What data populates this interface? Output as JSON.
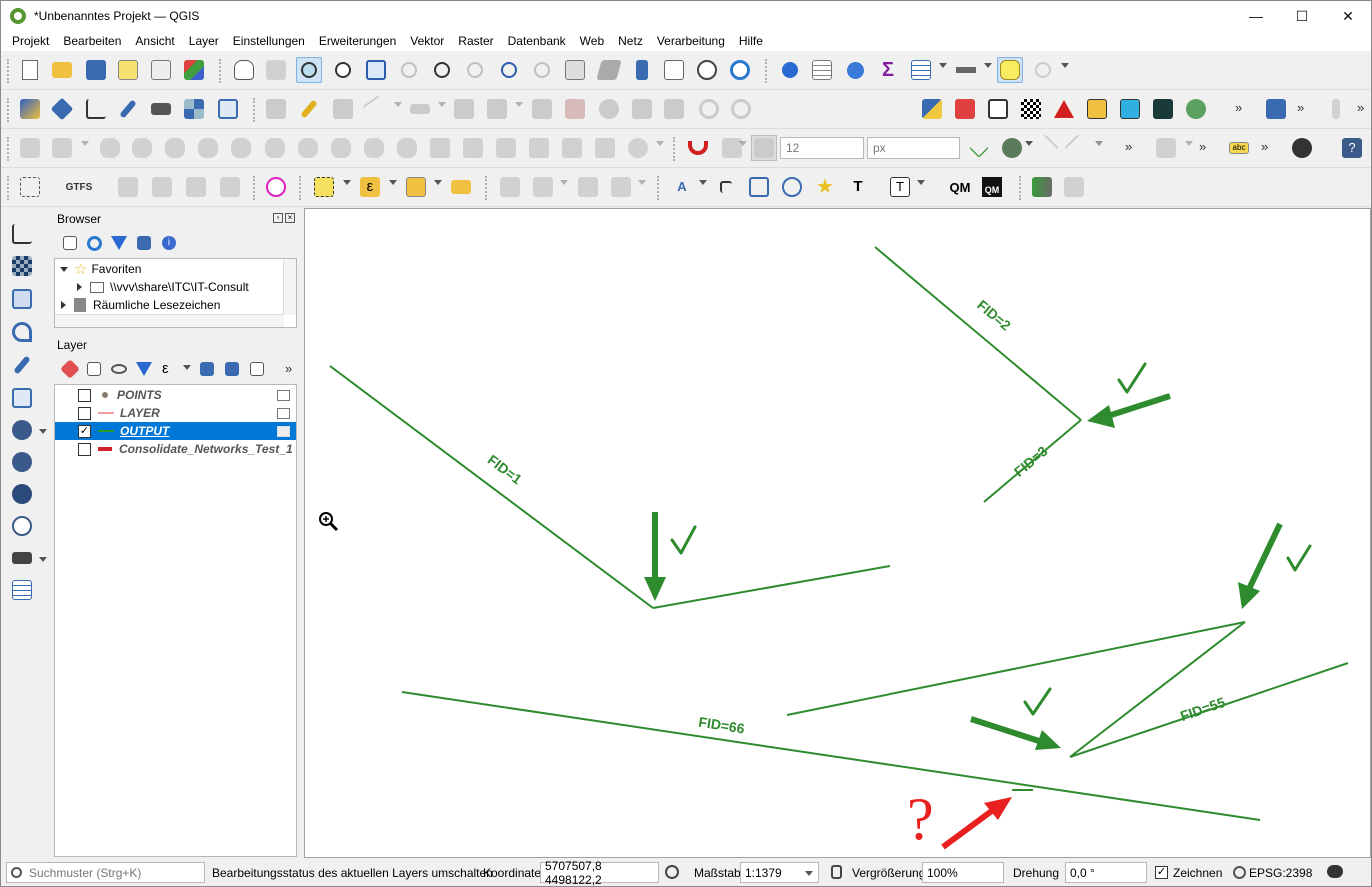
{
  "window": {
    "title": "*Unbenanntes Projekt — QGIS",
    "minimize": "—",
    "maximize": "☐",
    "close": "✕"
  },
  "menu": [
    "Projekt",
    "Bearbeiten",
    "Ansicht",
    "Layer",
    "Einstellungen",
    "Erweiterungen",
    "Vektor",
    "Raster",
    "Datenbank",
    "Web",
    "Netz",
    "Verarbeitung",
    "Hilfe"
  ],
  "toolbar": {
    "gtfs_label": "GTFS",
    "snap_tolerance": "12",
    "snap_unit": "px",
    "abc_label": "abc",
    "qm_label": "QM",
    "qm2_label": "QM",
    "more": "»"
  },
  "browser": {
    "title": "Browser",
    "items": [
      {
        "label": "Favoriten",
        "expanded": true
      },
      {
        "label": "\\\\vvv\\share\\ITC\\IT-Consult"
      },
      {
        "label": "Räumliche Lesezeichen"
      }
    ]
  },
  "layers": {
    "title": "Layer",
    "items": [
      {
        "name": "POINTS",
        "checked": false,
        "selected": false,
        "color": "#8a7a6a"
      },
      {
        "name": "LAYER",
        "checked": false,
        "selected": false,
        "color": "#f0a0a0"
      },
      {
        "name": "OUTPUT",
        "checked": true,
        "selected": true,
        "color": "#2a9a2a",
        "check_mark": "✓"
      },
      {
        "name": "Consolidate_Networks_Test_1",
        "checked": false,
        "selected": false,
        "color": "#d0202a"
      }
    ]
  },
  "map": {
    "line_color": "#2e8b2e",
    "labels": [
      "FID=2",
      "FID=3",
      "FID=1",
      "FID=55",
      "FID=66"
    ],
    "question_mark": "?",
    "question_color": "#e82020"
  },
  "status": {
    "search_placeholder": "Suchmuster (Strg+K)",
    "message": "Bearbeitungsstatus des aktuellen Layers umschalten",
    "coord_label": "Koordinate",
    "coord_value": "5707507,8 4498122,2",
    "scale_label": "Maßstab",
    "scale_value": "1:1379",
    "magnifier_label": "Vergrößerung",
    "magnifier_value": "100%",
    "rotation_label": "Drehung",
    "rotation_value": "0,0 °",
    "render_label": "Zeichnen",
    "render_check": "✓",
    "crs": "EPSG:2398"
  }
}
